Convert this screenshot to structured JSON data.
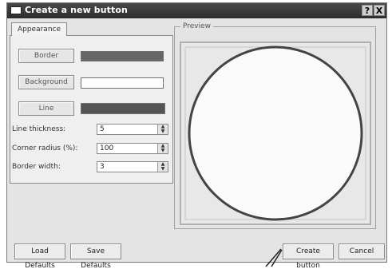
{
  "window": {
    "title": "Create a new button",
    "help_label": "?",
    "close_label": "X"
  },
  "tabs": [
    {
      "label": "Appearance",
      "active": true
    }
  ],
  "appearance": {
    "border_button": "Border",
    "background_button": "Background",
    "line_button": "Line",
    "border_color": "#666666",
    "background_color": "#ffffff",
    "line_color": "#555555",
    "line_thickness": {
      "label": "Line thickness:",
      "value": "5"
    },
    "corner_radius": {
      "label": "Corner radius (%):",
      "value": "100"
    },
    "border_width": {
      "label": "Border width:",
      "value": "3"
    }
  },
  "preview": {
    "label": "Preview",
    "fill": "#fafafa",
    "stroke": "#444444"
  },
  "buttons": {
    "load_defaults": "Load Defaults",
    "save_defaults": "Save Defaults",
    "create_button": "Create button",
    "cancel": "Cancel"
  }
}
